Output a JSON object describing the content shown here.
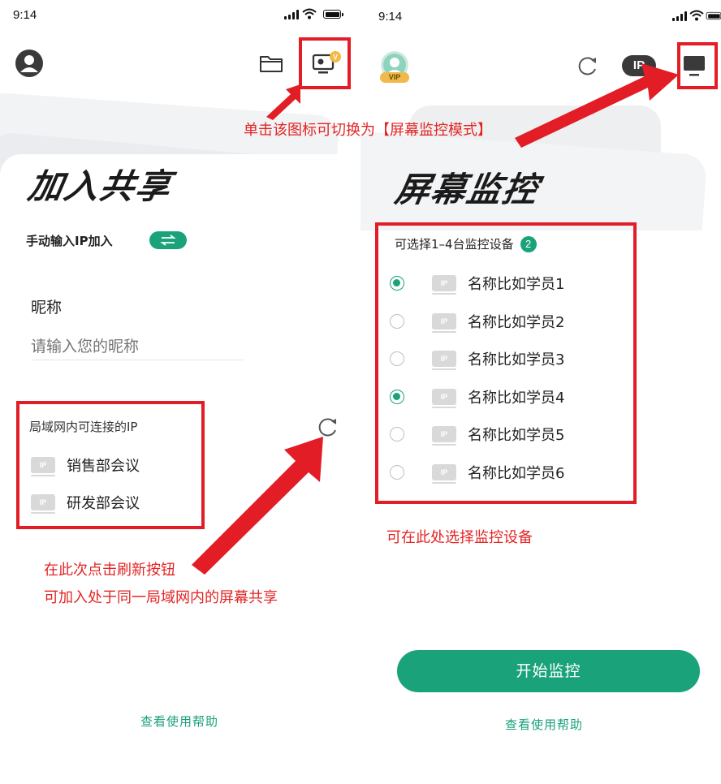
{
  "left": {
    "status": {
      "time": "9:14"
    },
    "title": "加入共享",
    "manual_label": "手动输入IP加入",
    "nickname_label": "昵称",
    "nickname_placeholder": "请输入您的昵称",
    "lan_title": "局域网内可连接的IP",
    "ip_badge": "IP",
    "lan_items": [
      "销售部会议",
      "研发部会议"
    ],
    "help_link": "查看使用帮助",
    "annotations": {
      "switch_tip": "单击该图标可切换为【屏幕监控模式】",
      "refresh_tip_1": "在此次点击刷新按钮",
      "refresh_tip_2": "可加入处于同一局域网内的屏幕共享"
    }
  },
  "right": {
    "status": {
      "time": "9:14"
    },
    "vip_badge": "VIP",
    "ip_button": "IP",
    "title": "屏幕监控",
    "select_label": "可选择1–4台监控设备",
    "selected_count": "2",
    "ip_badge": "IP",
    "devices": [
      {
        "name": "名称比如学员1",
        "selected": true
      },
      {
        "name": "名称比如学员2",
        "selected": false
      },
      {
        "name": "名称比如学员3",
        "selected": false
      },
      {
        "name": "名称比如学员4",
        "selected": true
      },
      {
        "name": "名称比如学员5",
        "selected": false
      },
      {
        "name": "名称比如学员6",
        "selected": false
      }
    ],
    "select_tip": "可在此处选择监控设备",
    "start_button": "开始监控",
    "help_link": "查看使用帮助"
  },
  "colors": {
    "accent_green": "#1aa37a",
    "annotation_red": "#e21d26"
  }
}
